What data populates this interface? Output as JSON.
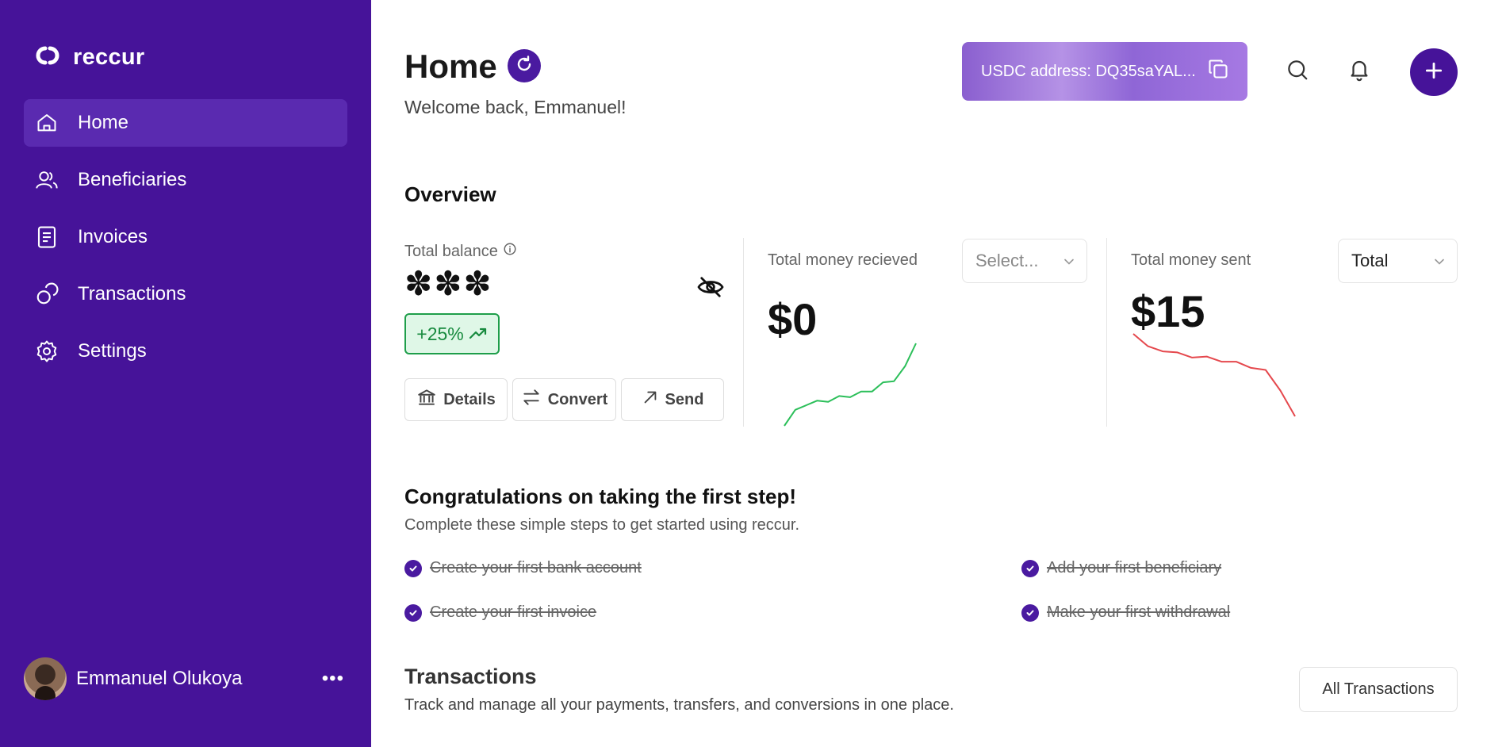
{
  "app": {
    "brand": "reccur"
  },
  "sidebar": {
    "items": [
      {
        "label": "Home",
        "icon": "home-icon",
        "active": true
      },
      {
        "label": "Beneficiaries",
        "icon": "users-icon"
      },
      {
        "label": "Invoices",
        "icon": "document-icon"
      },
      {
        "label": "Transactions",
        "icon": "coins-icon"
      },
      {
        "label": "Settings",
        "icon": "gear-icon"
      }
    ],
    "user": {
      "name": "Emmanuel Olukoya",
      "more": "•••"
    }
  },
  "header": {
    "title": "Home",
    "welcome": "Welcome back, Emmanuel!",
    "usdc_address": "USDC address: DQ35saYAL...",
    "accent_color": "#461399"
  },
  "overview": {
    "title": "Overview",
    "total_balance_label": "Total balance",
    "balance_hidden": "***",
    "change_badge": "+25%",
    "actions": {
      "details": "Details",
      "convert": "Convert",
      "send": "Send"
    },
    "received": {
      "label": "Total money recieved",
      "select_placeholder": "Select...",
      "amount": "$0",
      "trend_color": "#2cbf5a",
      "sparkline": [
        0,
        14,
        18,
        22,
        21,
        26,
        25,
        30,
        30,
        38,
        39,
        52,
        72
      ]
    },
    "sent": {
      "label": "Total money sent",
      "select_value": "Total",
      "amount": "$15",
      "trend_color": "#e5484d",
      "sparkline": [
        100,
        88,
        83,
        82,
        77,
        78,
        73,
        73,
        67,
        65,
        45,
        20
      ]
    }
  },
  "getting_started": {
    "title": "Congratulations on taking the first step!",
    "subtitle": "Complete these simple steps to get started using reccur.",
    "steps": [
      "Create your first bank account",
      "Add your first beneficiary",
      "Create your first invoice",
      "Make your first withdrawal"
    ]
  },
  "transactions": {
    "title": "Transactions",
    "subtitle": "Track and manage all your payments, transfers, and conversions in one place.",
    "all_button": "All Transactions"
  }
}
